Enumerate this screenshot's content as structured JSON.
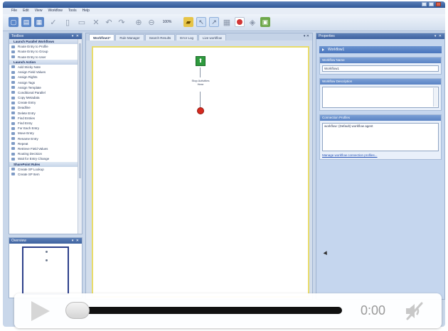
{
  "window": {
    "title": "",
    "menu": [
      "File",
      "Edit",
      "View",
      "Workflow",
      "Tools",
      "Help"
    ]
  },
  "toolbar": {
    "zoom": "100%"
  },
  "toolbox": {
    "title": "Toolbox",
    "items": [
      {
        "label": "Launch Parallel Workflows",
        "kind": "cat"
      },
      {
        "label": "Route Entry to Profile",
        "kind": "item"
      },
      {
        "label": "Route Entry to Group",
        "kind": "item"
      },
      {
        "label": "Route Entry to User",
        "kind": "item"
      },
      {
        "label": "Launch Action",
        "kind": "cat"
      },
      {
        "label": "Add Sticky Note",
        "kind": "item"
      },
      {
        "label": "Assign Field Values",
        "kind": "item"
      },
      {
        "label": "Assign Rights",
        "kind": "item"
      },
      {
        "label": "Assign Tags",
        "kind": "item"
      },
      {
        "label": "Assign Template",
        "kind": "item"
      },
      {
        "label": "Conditional Parallel",
        "kind": "item"
      },
      {
        "label": "Copy Metadata",
        "kind": "item"
      },
      {
        "label": "Create Entry",
        "kind": "item"
      },
      {
        "label": "Deadline",
        "kind": "item"
      },
      {
        "label": "Delete Entry",
        "kind": "item"
      },
      {
        "label": "Find Entries",
        "kind": "item"
      },
      {
        "label": "Find Entry",
        "kind": "item"
      },
      {
        "label": "For Each Entry",
        "kind": "item"
      },
      {
        "label": "Move Entry",
        "kind": "item"
      },
      {
        "label": "Rename Entry",
        "kind": "item"
      },
      {
        "label": "Repeat",
        "kind": "item"
      },
      {
        "label": "Retrieve Field Values",
        "kind": "item"
      },
      {
        "label": "Routing Decision",
        "kind": "item"
      },
      {
        "label": "Wait for Entry Change",
        "kind": "item"
      },
      {
        "label": "SharePoint Rules",
        "kind": "cat"
      },
      {
        "label": "Create SP Lookup",
        "kind": "item"
      },
      {
        "label": "Create SP Item",
        "kind": "item"
      }
    ]
  },
  "minimap": {
    "title": "Overview"
  },
  "designer": {
    "tabs": [
      {
        "label": "Workflow1*",
        "active": true
      },
      {
        "label": "Rule Manager",
        "active": false
      },
      {
        "label": "Search Results",
        "active": false
      },
      {
        "label": "Error Log",
        "active": false
      },
      {
        "label": "Live workflow",
        "active": false
      }
    ],
    "step_label": "Stop Activities Here"
  },
  "properties": {
    "title": "Properties",
    "header": "Workflow1",
    "name_section": "Workflow Name",
    "name_value": "Workflow1",
    "desc_section": "Workflow Description",
    "desc_value": "",
    "conn_section": "Connection Profiles",
    "conn_value": "workflow: (Default) workflow agent",
    "conn_link": "Manage workflow connection profiles..."
  },
  "player": {
    "time": "0:00",
    "progress": 0.0,
    "muted": true
  },
  "colors": {
    "start_node": "#2e9a3e",
    "end_node": "#d62a1f",
    "canvas_border": "#e9dc6a",
    "panel_header": "#4a76bd"
  }
}
